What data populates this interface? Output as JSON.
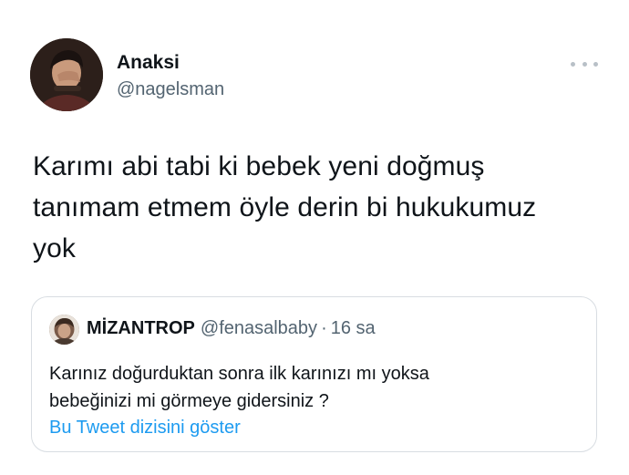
{
  "tweet": {
    "author": {
      "name": "Anaksi",
      "handle": "@nagelsman"
    },
    "text_lines": [
      "Karımı abi tabi ki bebek yeni doğmuş",
      "tanımam etmem öyle derin bi hukukumuz",
      "yok"
    ],
    "more_icon": "more-horizontal-icon"
  },
  "quoted_tweet": {
    "author": {
      "name": "MİZANTROP",
      "handle": "@fenasalbaby"
    },
    "separator": "·",
    "time": "16 sa",
    "text_lines": [
      "Karınız doğurduktan sonra ilk karınızı mı yoksa",
      "bebeğinizi mi görmeye gidersiniz ?"
    ],
    "show_thread_label": "Bu Tweet dizisini göster"
  },
  "colors": {
    "primary_text": "#0f1419",
    "secondary_text": "#536471",
    "link": "#1d9bf0",
    "border": "#d8dde2"
  }
}
